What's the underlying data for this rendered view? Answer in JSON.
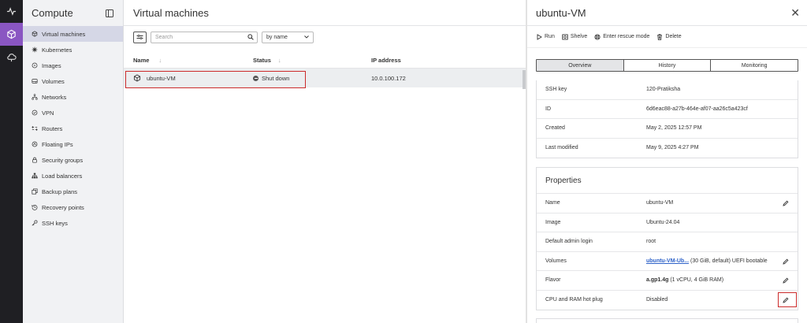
{
  "sidebar": {
    "title": "Compute",
    "items": [
      {
        "label": "Virtual machines",
        "icon": "cube-icon",
        "active": true
      },
      {
        "label": "Kubernetes",
        "icon": "helm-icon"
      },
      {
        "label": "Images",
        "icon": "disc-icon"
      },
      {
        "label": "Volumes",
        "icon": "drive-icon"
      },
      {
        "label": "Networks",
        "icon": "network-icon"
      },
      {
        "label": "VPN",
        "icon": "shield-icon"
      },
      {
        "label": "Routers",
        "icon": "router-icon"
      },
      {
        "label": "Floating IPs",
        "icon": "floating-ip-icon"
      },
      {
        "label": "Security groups",
        "icon": "lock-icon"
      },
      {
        "label": "Load balancers",
        "icon": "load-balancer-icon"
      },
      {
        "label": "Backup plans",
        "icon": "backup-icon"
      },
      {
        "label": "Recovery points",
        "icon": "recovery-icon"
      },
      {
        "label": "SSH keys",
        "icon": "key-icon"
      }
    ]
  },
  "main": {
    "title": "Virtual machines",
    "search_placeholder": "Search",
    "sort_value": "by name",
    "columns": {
      "name": "Name",
      "status": "Status",
      "ip": "IP address"
    },
    "rows": [
      {
        "name": "ubuntu-VM",
        "status": "Shut down",
        "ip": "10.0.100.172"
      }
    ]
  },
  "panel": {
    "title": "ubuntu-VM",
    "actions": {
      "run": "Run",
      "shelve": "Shelve",
      "rescue": "Enter rescue mode",
      "delete": "Delete"
    },
    "tabs": [
      "Overview",
      "History",
      "Monitoring"
    ],
    "overview": {
      "ssh_key_label": "SSH key",
      "ssh_key": "120-Pratiksha",
      "id_label": "ID",
      "id": "6d6eac88-a27b-464e-af07-aa26c5a423cf",
      "created_label": "Created",
      "created": "May 2, 2025 12:57 PM",
      "modified_label": "Last modified",
      "modified": "May 9, 2025 4:27 PM"
    },
    "properties": {
      "title": "Properties",
      "name_label": "Name",
      "name": "ubuntu-VM",
      "image_label": "Image",
      "image": "Ubuntu-24.04",
      "admin_label": "Default admin login",
      "admin": "root",
      "volumes_label": "Volumes",
      "volumes_link": "ubuntu-VM-Ub...",
      "volumes_rest": " (30 GiB, default) UEFI bootable",
      "flavor_label": "Flavor",
      "flavor_name": "a.gp1.4g",
      "flavor_rest": " (1 vCPU, 4 GiB RAM)",
      "cpu_label": "CPU and RAM hot plug",
      "cpu": "Disabled"
    }
  }
}
